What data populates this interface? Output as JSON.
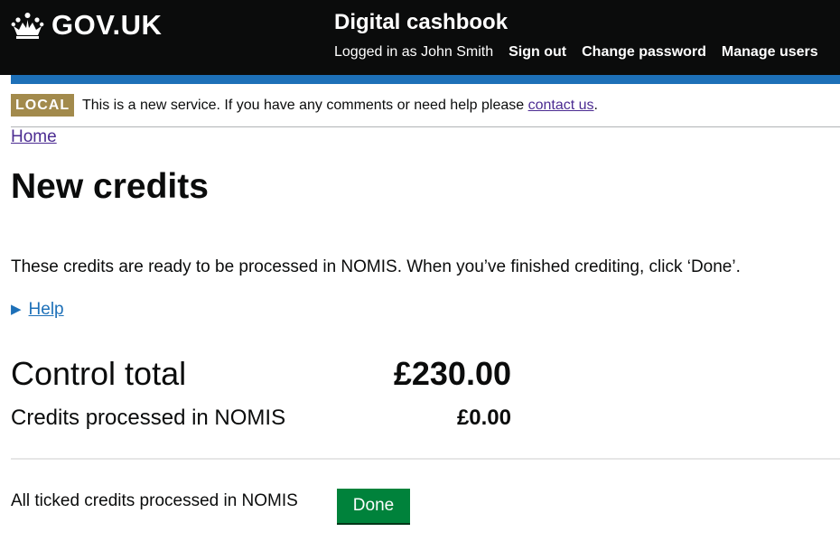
{
  "header": {
    "logo_text": "GOV.UK",
    "service_name": "Digital cashbook",
    "logged_in_text": "Logged in as John Smith",
    "links": [
      "Sign out",
      "Change password",
      "Manage users"
    ],
    "background_color": "#0b0c0c",
    "accent_color": "#1d70b8"
  },
  "phase_banner": {
    "tag": "LOCAL",
    "text": "This is a new service. If you have any comments or need help please ",
    "link_text": "contact us",
    "after_link": ".",
    "tag_color": "#a28a4c"
  },
  "breadcrumb": {
    "home": "Home"
  },
  "page": {
    "title": "New credits",
    "intro": "These credits are ready to be processed in NOMIS. When you’ve finished crediting, click ‘Done’.",
    "help_label": "Help"
  },
  "totals": {
    "control_total_label": "Control total",
    "control_total_value": "£230.00",
    "processed_label": "Credits processed in NOMIS",
    "processed_value": "£0.00"
  },
  "footer_action": {
    "text": "All ticked credits processed in NOMIS",
    "button_label": "Done",
    "button_color": "#00823b"
  },
  "icons": {
    "logo": "crown-icon",
    "help_toggle": "triangle-right-icon"
  }
}
